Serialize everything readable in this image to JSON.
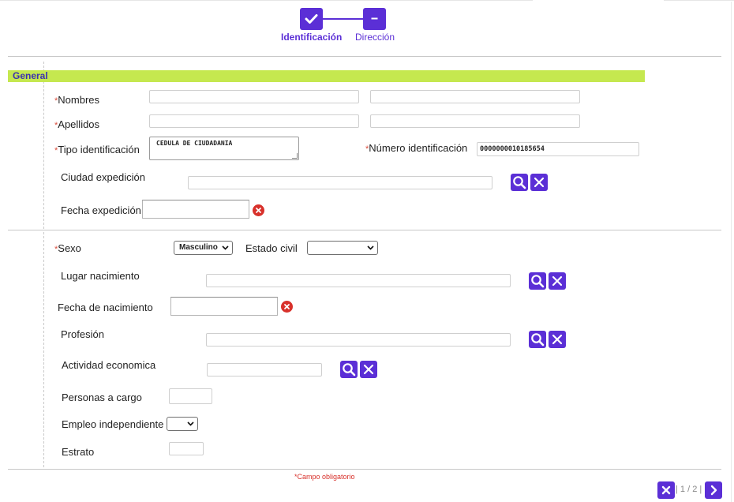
{
  "stepper": {
    "steps": [
      {
        "label": "Identificación",
        "state": "completed",
        "icon": "check-icon"
      },
      {
        "label": "Dirección",
        "state": "current",
        "icon": "minus-icon"
      }
    ]
  },
  "section": {
    "title": "General"
  },
  "required_marker": "*",
  "fields": {
    "nombres": {
      "label": "Nombres",
      "value1": "",
      "value2": ""
    },
    "apellidos": {
      "label": "Apellidos",
      "value1": "",
      "value2": ""
    },
    "tipo_identificacion": {
      "label": "Tipo identificación",
      "value": "CEDULA DE CIUDADANIA"
    },
    "numero_identificacion": {
      "label": "Número identificación",
      "value": "0000000010185654"
    },
    "ciudad_expedicion": {
      "label": "Ciudad expedición",
      "value": ""
    },
    "fecha_expedicion": {
      "label": "Fecha expedición",
      "value": ""
    },
    "sexo": {
      "label": "Sexo",
      "value": "Masculino"
    },
    "estado_civil": {
      "label": "Estado civil",
      "value": ""
    },
    "lugar_nacimiento": {
      "label": "Lugar nacimiento",
      "value": ""
    },
    "fecha_nacimiento": {
      "label": "Fecha de nacimiento",
      "value": ""
    },
    "profesion": {
      "label": "Profesión",
      "value": ""
    },
    "actividad_economica": {
      "label": "Actividad economica",
      "value": ""
    },
    "personas_a_cargo": {
      "label": "Personas a cargo",
      "value": ""
    },
    "empleo_independiente": {
      "label": "Empleo independiente",
      "value": ""
    },
    "estrato": {
      "label": "Estrato",
      "value": ""
    }
  },
  "footer": {
    "required_note": "Campo obligatorio",
    "pager": "| 1 / 2 |"
  },
  "colors": {
    "accent": "#5b2fd6",
    "section_bar": "#c5e84f",
    "required": "#d94b3b",
    "clear_red": "#d8312b"
  }
}
